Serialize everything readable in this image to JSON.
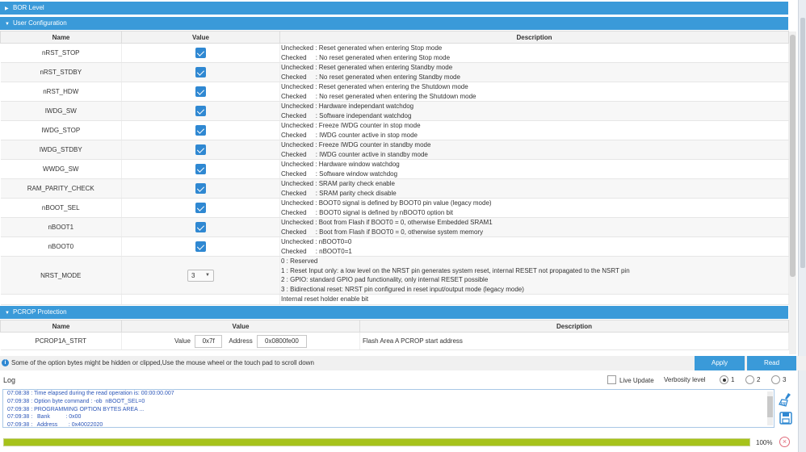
{
  "sections": {
    "bor_level": "BOR Level",
    "user_config": "User Configuration",
    "pcrop": "PCROP Protection"
  },
  "user_table": {
    "headers": {
      "name": "Name",
      "value": "Value",
      "description": "Description"
    },
    "rows": [
      {
        "name": "nRST_STOP",
        "checked": true,
        "desc1": "Unchecked : Reset generated when entering Stop mode",
        "desc2": "Checked     : No reset generated when entering Stop mode"
      },
      {
        "name": "nRST_STDBY",
        "checked": true,
        "desc1": "Unchecked : Reset generated when entering Standby mode",
        "desc2": "Checked     : No reset generated when entering Standby mode"
      },
      {
        "name": "nRST_HDW",
        "checked": true,
        "desc1": "Unchecked : Reset generated when entering the Shutdown mode",
        "desc2": "Checked     : No reset generated when entering the Shutdown mode"
      },
      {
        "name": "IWDG_SW",
        "checked": true,
        "desc1": "Unchecked : Hardware independant watchdog",
        "desc2": "Checked     : Software independant watchdog"
      },
      {
        "name": "IWDG_STOP",
        "checked": true,
        "desc1": "Unchecked : Freeze IWDG counter in stop mode",
        "desc2": "Checked     : IWDG counter active in stop mode"
      },
      {
        "name": "IWDG_STDBY",
        "checked": true,
        "desc1": "Unchecked : Freeze IWDG counter in standby mode",
        "desc2": "Checked     : IWDG counter active in standby mode"
      },
      {
        "name": "WWDG_SW",
        "checked": true,
        "desc1": "Unchecked : Hardware window watchdog",
        "desc2": "Checked     : Software window watchdog"
      },
      {
        "name": "RAM_PARITY_CHECK",
        "checked": true,
        "desc1": "Unchecked : SRAM parity check enable",
        "desc2": "Checked     : SRAM parity check disable"
      },
      {
        "name": "nBOOT_SEL",
        "checked": true,
        "desc1": "Unchecked : BOOT0 signal is defined by BOOT0 pin value (legacy mode)",
        "desc2": "Checked     : BOOT0 signal is defined by nBOOT0 option bit"
      },
      {
        "name": "nBOOT1",
        "checked": true,
        "desc1": "Unchecked : Boot from Flash if BOOT0 = 0, otherwise Embedded SRAM1",
        "desc2": "Checked     : Boot from Flash if BOOT0 = 0, otherwise system memory"
      },
      {
        "name": "nBOOT0",
        "checked": true,
        "desc1": "Unchecked : nBOOT0=0",
        "desc2": "Checked     : nBOOT0=1"
      }
    ],
    "nrst_mode": {
      "name": "NRST_MODE",
      "value": "3",
      "desc": [
        "0 : Reserved",
        "1 : Reset Input only: a low level on the NRST pin generates system reset, internal RESET not propagated to the NSRT pin",
        "2 : GPIO: standard GPIO pad functionality, only internal RESET possible",
        "3 : Bidirectional reset: NRST pin configured in reset input/output mode (legacy mode)"
      ]
    },
    "partial_desc": "Internal reset holder enable bit"
  },
  "pcrop_table": {
    "headers": {
      "name": "Name",
      "value": "Value",
      "description": "Description"
    },
    "row": {
      "name": "PCROP1A_STRT",
      "value_label": "Value",
      "value": "0x7f",
      "address_label": "Address",
      "address": "0x0800fe00",
      "description": "Flash Area A PCROP start address"
    }
  },
  "info": {
    "icon": "info-icon",
    "text": "Some of the option bytes might be hidden or clipped,Use the mouse wheel or the touch pad to scroll down"
  },
  "buttons": {
    "apply": "Apply",
    "read": "Read"
  },
  "log": {
    "title": "Log",
    "live_update": "Live Update",
    "live_update_checked": false,
    "verbosity_label": "Verbosity level",
    "verbosity_options": [
      "1",
      "2",
      "3"
    ],
    "verbosity_selected": "1",
    "lines": [
      "07:08:38 : Time elapsed during the read operation is: 00:00:00.007",
      "07:09:38 : Option byte command : -ob  nBOOT_SEL=0",
      "07:09:38 : PROGRAMMING OPTION BYTES AREA ...",
      "07:09:38 :   Bank          : 0x00",
      "07:09:38 :   Address       : 0x40022020"
    ]
  },
  "progress": {
    "percent_text": "100%",
    "fraction": 1.0
  },
  "colors": {
    "accent": "#3a9ad9",
    "checkbox": "#2f88d2",
    "progress": "#a6c21a",
    "log_text": "#2c56b8"
  }
}
